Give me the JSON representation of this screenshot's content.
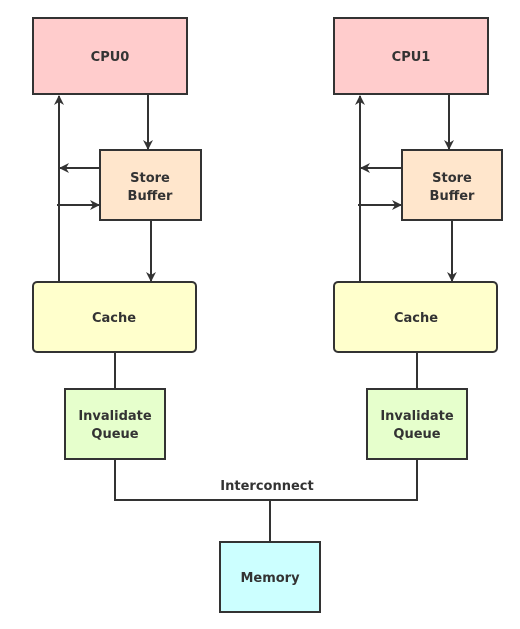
{
  "labels": {
    "cpu0": "CPU0",
    "cpu1": "CPU1",
    "store_buffer_line1": "Store",
    "store_buffer_line2": "Buffer",
    "cache": "Cache",
    "invalidate_queue_line1": "Invalidate",
    "invalidate_queue_line2": "Queue",
    "interconnect": "Interconnect",
    "memory": "Memory"
  },
  "colors": {
    "cpu": "#ffcccc",
    "store_buffer": "#ffe6cc",
    "cache": "#ffffcc",
    "invalidate_queue": "#e6ffcc",
    "memory": "#ccffff",
    "stroke": "#333333"
  }
}
